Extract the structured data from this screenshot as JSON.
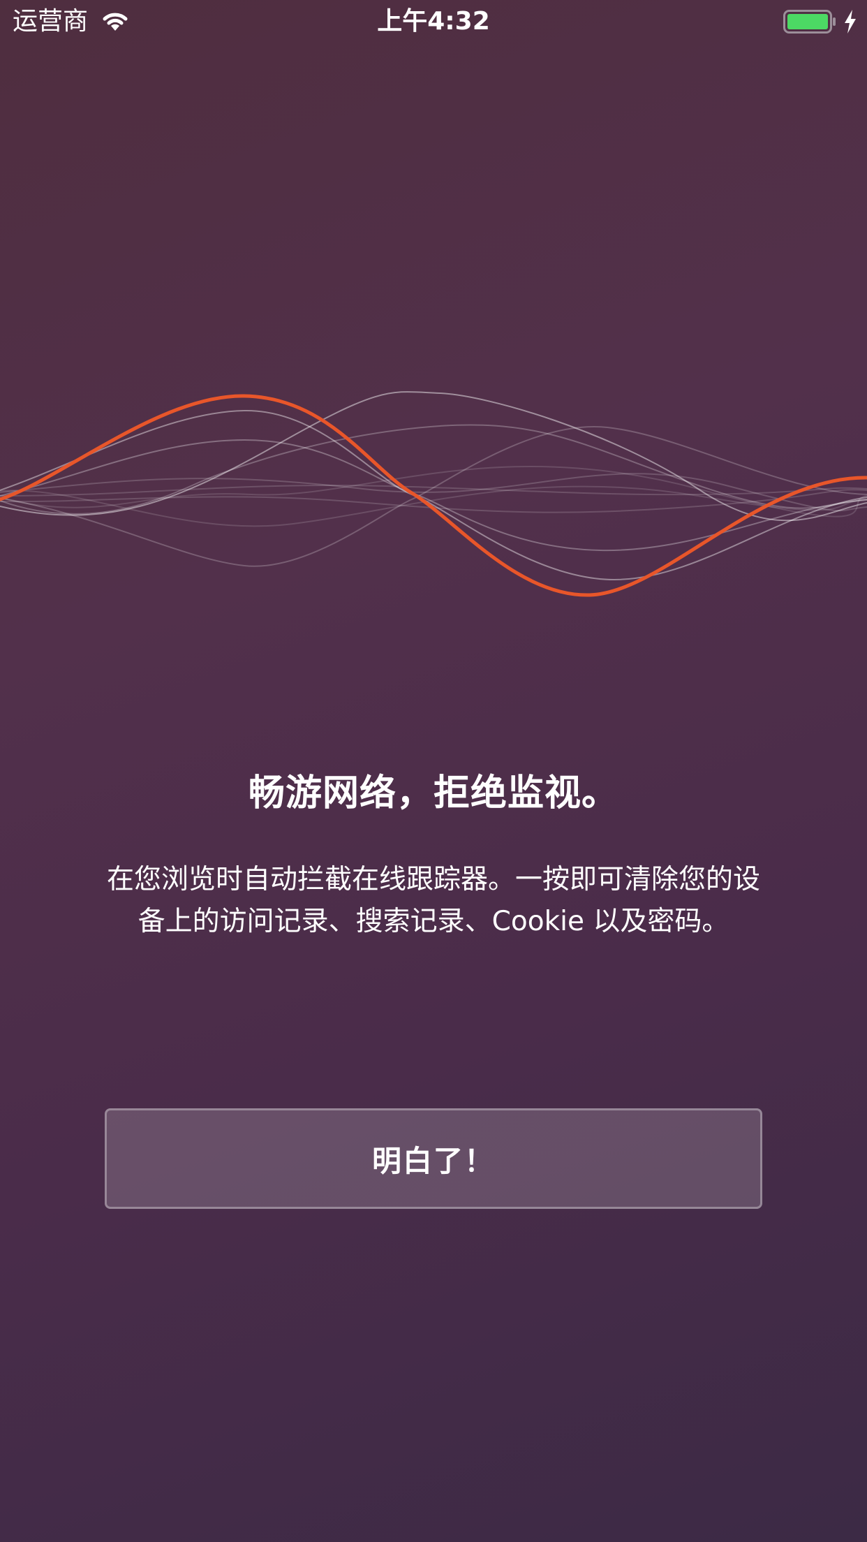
{
  "status_bar": {
    "carrier": "运营商",
    "time": "上午4:32",
    "battery_color": "#4cd964"
  },
  "onboarding": {
    "headline": "畅游网络，拒绝监视。",
    "description": "在您浏览时自动拦截在线跟踪器。一按即可清除您的设备上的访问记录、搜索记录、Cookie 以及密码。",
    "button_label": "明白了！"
  },
  "colors": {
    "accent_wave": "#e8562a",
    "background_top": "#4f2e3f",
    "background_bottom": "#3c2a45"
  }
}
